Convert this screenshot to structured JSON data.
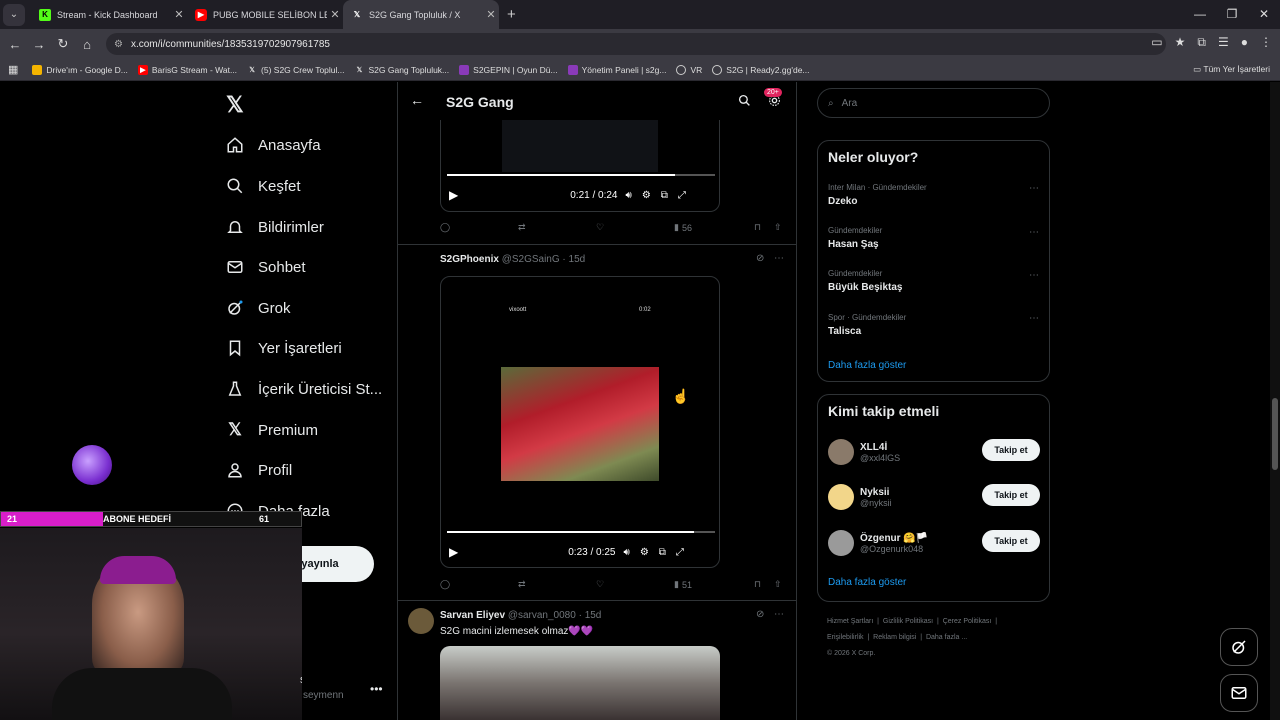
{
  "browser": {
    "tabs": [
      {
        "title": "Stream - Kick Dashboard",
        "icon": "kick-icon"
      },
      {
        "title": "PUBG MOBILE SELİBON LEAGUE",
        "icon": "youtube-icon"
      },
      {
        "title": "S2G Gang Topluluk / X",
        "icon": "x-icon",
        "active": true
      }
    ],
    "url": "x.com/i/communities/1835319702907961785",
    "bookmarks": [
      "Drive'ım - Google D...",
      "BarisG Stream - Wat...",
      "(5) S2G Crew Toplul...",
      "S2G Gang Topluluk...",
      "S2GEPIN | Oyun Dü...",
      "Yönetim Paneli | s2g...",
      "VR",
      "S2G | Ready2.gg'de..."
    ],
    "bookmarks_all": "Tüm Yer İşaretleri"
  },
  "sidebar": {
    "items": [
      {
        "label": "Anasayfa",
        "icon": "home-icon"
      },
      {
        "label": "Keşfet",
        "icon": "search-icon"
      },
      {
        "label": "Bildirimler",
        "icon": "bell-icon"
      },
      {
        "label": "Sohbet",
        "icon": "mail-icon"
      },
      {
        "label": "Grok",
        "icon": "grok-icon"
      },
      {
        "label": "Yer İşaretleri",
        "icon": "bookmark-icon"
      },
      {
        "label": "İçerik Üreticisi St...",
        "icon": "flask-icon"
      },
      {
        "label": "Premium",
        "icon": "x-premium-icon"
      },
      {
        "label": "Profil",
        "icon": "person-icon"
      },
      {
        "label": "Daha fazla",
        "icon": "more-circle-icon"
      }
    ],
    "post_button": "yayınla",
    "account_handle": "seymenn",
    "account_initial": "s"
  },
  "main": {
    "title": "S2G Gang",
    "badge": "20+",
    "video1": {
      "time": "0:21 / 0:24",
      "progress": 0.85,
      "views": "56"
    },
    "post2": {
      "author": "S2GPhoenix",
      "handle": "@S2GSainG · 15d",
      "overlay_left": "vixoott",
      "overlay_right": "0:02",
      "time": "0:23 / 0:25",
      "progress": 0.92,
      "views": "51"
    },
    "post3": {
      "author": "Sarvan Eliyev",
      "handle": "@sarvan_0080 · 15d",
      "text": "S2G macini izlemesek olmaz💜💜"
    }
  },
  "right": {
    "search_placeholder": "Ara",
    "trends_title": "Neler oluyor?",
    "trends": [
      {
        "meta": "Inter Milan · Gündemdekiler",
        "name": "Dzeko"
      },
      {
        "meta": "Gündemdekiler",
        "name": "Hasan Şaş"
      },
      {
        "meta": "Gündemdekiler",
        "name": "Büyük Beşiktaş"
      },
      {
        "meta": "Spor · Gündemdekiler",
        "name": "Talisca"
      }
    ],
    "trends_more": "Daha fazla göster",
    "who_title": "Kimi takip etmeli",
    "who": [
      {
        "name": "XLL4İ",
        "handle": "@xxl4lGS"
      },
      {
        "name": "Nyksii",
        "handle": "@nyksii"
      },
      {
        "name": "Özgenur 🤗🏳️",
        "handle": "@Ozgenurk048"
      }
    ],
    "follow_label": "Takip et",
    "who_more": "Daha fazla göster",
    "footer": [
      "Hizmet Şartları",
      "Gizlilik Politikası",
      "Çerez Politikası",
      "Erişilebilirlik",
      "Reklam bilgisi",
      "Daha fazla ...",
      "© 2026 X Corp."
    ]
  },
  "stream": {
    "goal_count": "21",
    "goal_label": "ABONE HEDEFİ",
    "goal_target": "61"
  }
}
